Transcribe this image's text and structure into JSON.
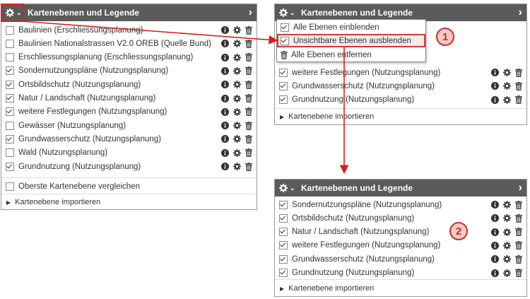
{
  "panel": {
    "title": "Kartenebenen und Legende",
    "import_label": "Kartenebene importieren"
  },
  "left_panel": {
    "layers": [
      {
        "label": "Baulinien (Erschliessungsplanung)",
        "checked": false
      },
      {
        "label": "Baulinien Nationalstrassen V2.0 ÖREB (Quelle Bund)",
        "checked": false
      },
      {
        "label": "Erschliessungsplanung (Erschliessungsplanung)",
        "checked": false
      },
      {
        "label": "Sondernutzungspläne (Nutzungsplanung)",
        "checked": true
      },
      {
        "label": "Ortsbildschutz (Nutzungsplanung)",
        "checked": true
      },
      {
        "label": "Natur / Landschaft (Nutzungsplanung)",
        "checked": true
      },
      {
        "label": "weitere Festlegungen (Nutzungsplanung)",
        "checked": true
      },
      {
        "label": "Gewässer (Nutzungsplanung)",
        "checked": false
      },
      {
        "label": "Grundwasserschutz (Nutzungsplanung)",
        "checked": true
      },
      {
        "label": "Wald (Nutzungsplanung)",
        "checked": false
      },
      {
        "label": "Grundnutzung (Nutzungsplanung)",
        "checked": true
      }
    ],
    "compare_label": "Oberste Kartenebene vergleichen"
  },
  "menu": {
    "items": [
      {
        "label": "Alle Ebenen einblenden",
        "icon": "check-icon"
      },
      {
        "label": "Unsichtbare Ebenen ausblenden",
        "icon": "check-icon"
      },
      {
        "label": "Alle Ebenen entfernen",
        "icon": "trash-icon"
      }
    ]
  },
  "top_right_panel": {
    "layers": [
      {
        "label": "weitere Festlegungen (Nutzungsplanung)",
        "checked": true
      },
      {
        "label": "Grundwasserschutz (Nutzungsplanung)",
        "checked": true
      },
      {
        "label": "Grundnutzung (Nutzungsplanung)",
        "checked": true
      }
    ]
  },
  "bottom_right_panel": {
    "layers": [
      {
        "label": "Sondernutzungspläne (Nutzungsplanung)",
        "checked": true
      },
      {
        "label": "Ortsbildschutz (Nutzungsplanung)",
        "checked": true
      },
      {
        "label": "Natur / Landschaft (Nutzungsplanung)",
        "checked": true
      },
      {
        "label": "weitere Festlegungen (Nutzungsplanung)",
        "checked": true
      },
      {
        "label": "Grundwasserschutz (Nutzungsplanung)",
        "checked": true
      },
      {
        "label": "Grundnutzung (Nutzungsplanung)",
        "checked": true
      }
    ]
  },
  "annotations": {
    "step1": "1",
    "step2": "2"
  },
  "colors": {
    "header_bg": "#5b5b5b",
    "highlight_red": "#d62020",
    "badge_fill": "#f6c9c4"
  }
}
